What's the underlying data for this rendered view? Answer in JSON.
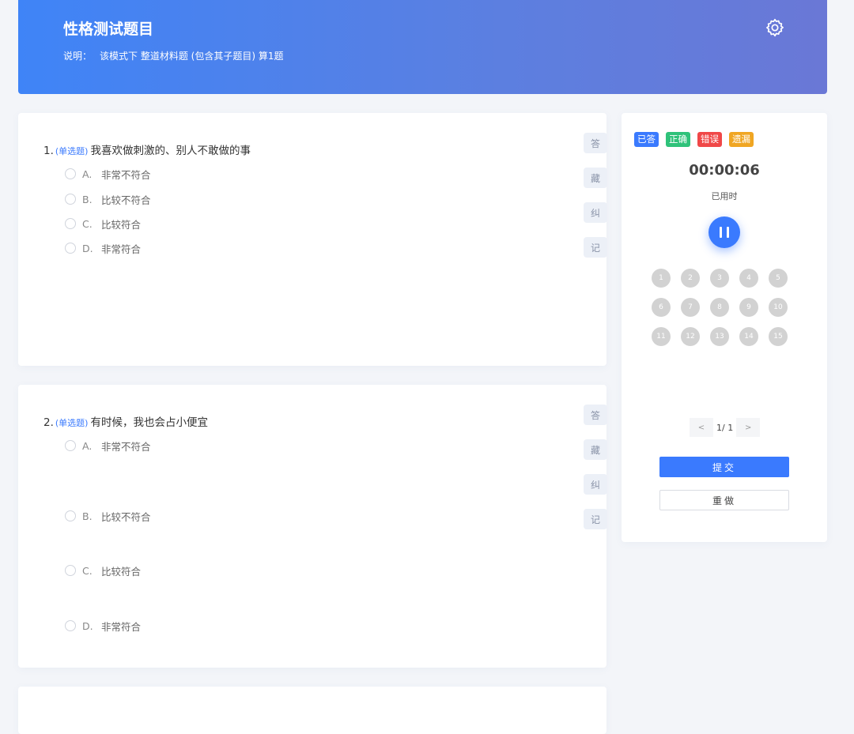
{
  "header": {
    "title": "性格测试题目",
    "desc_label": "说明：",
    "desc_text": "该模式下 整道材料题 (包含其子题目) 算1题",
    "settings_icon": "gear-icon"
  },
  "questions": [
    {
      "number": "1.",
      "type": "(单选题)",
      "text": "我喜欢做刺激的、别人不敢做的事",
      "options": [
        {
          "letter": "A.",
          "text": "非常不符合"
        },
        {
          "letter": "B.",
          "text": "比较不符合"
        },
        {
          "letter": "C.",
          "text": "比较符合"
        },
        {
          "letter": "D.",
          "text": "非常符合"
        }
      ],
      "tags": [
        "答",
        "藏",
        "纠",
        "记"
      ]
    },
    {
      "number": "2.",
      "type": "(单选题)",
      "text": "有时候，我也会占小便宜",
      "options": [
        {
          "letter": "A.",
          "text": "非常不符合"
        },
        {
          "letter": "B.",
          "text": "比较不符合"
        },
        {
          "letter": "C.",
          "text": "比较符合"
        },
        {
          "letter": "D.",
          "text": "非常符合"
        }
      ],
      "tags": [
        "答",
        "藏",
        "纠",
        "记"
      ]
    }
  ],
  "panel": {
    "legend": [
      {
        "label": "已答",
        "color": "#3a7afe"
      },
      {
        "label": "正确",
        "color": "#2fc27a"
      },
      {
        "label": "错误",
        "color": "#f04848"
      },
      {
        "label": "遗漏",
        "color": "#f0a623"
      }
    ],
    "timer": "00:00:06",
    "timer_label": "已用时",
    "numbers": [
      "1",
      "2",
      "3",
      "4",
      "5",
      "6",
      "7",
      "8",
      "9",
      "10",
      "11",
      "12",
      "13",
      "14",
      "15"
    ],
    "pager": {
      "prev": "<",
      "text": "1/ 1",
      "next": ">"
    },
    "submit_label": "提交",
    "redo_label": "重做"
  }
}
